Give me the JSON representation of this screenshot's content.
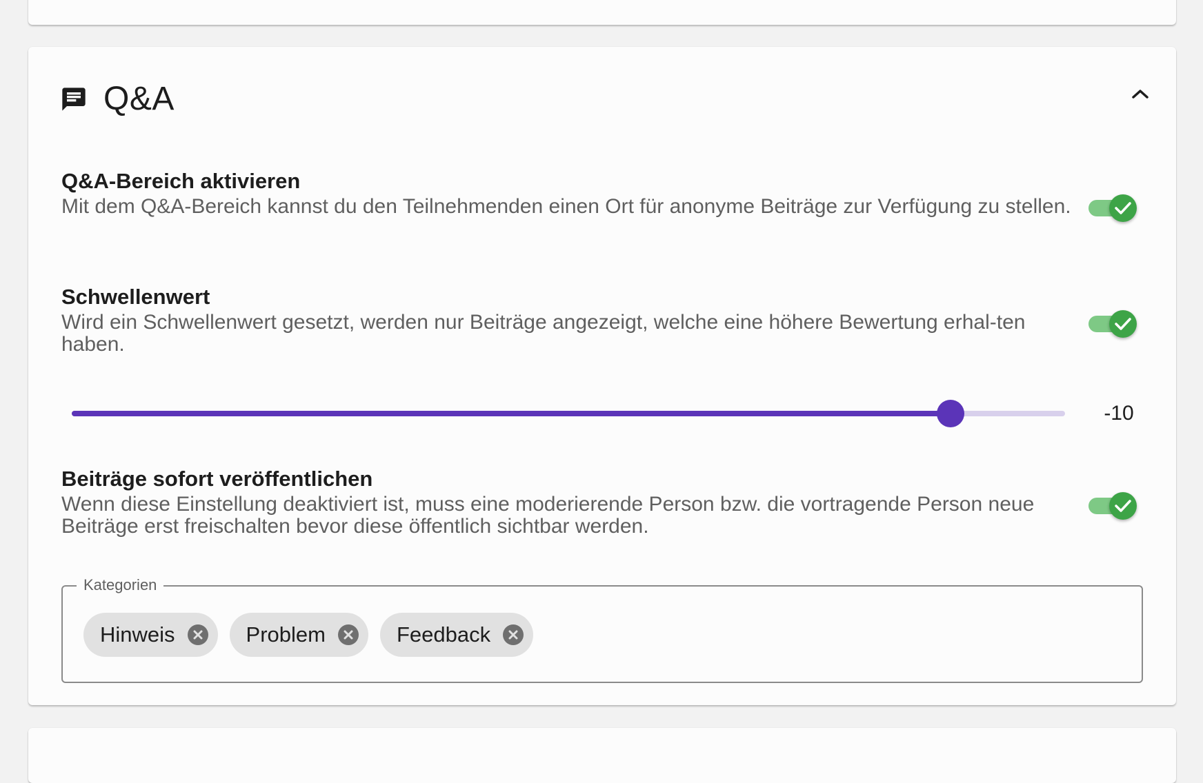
{
  "section": {
    "title": "Q&A",
    "icon": "chat-icon",
    "collapse_icon": "chevron-up-icon"
  },
  "settings": [
    {
      "title": "Q&A-Bereich aktivieren",
      "description": "Mit dem Q&A-Bereich kannst du den Teilnehmenden einen Ort für anonyme Beiträge zur Verfügung zu stellen.",
      "enabled": true
    },
    {
      "title": "Schwellenwert",
      "description": "Wird ein Schwellenwert gesetzt, werden nur Beiträge angezeigt, welche eine höhere Bewertung erhal-ten haben.",
      "enabled": true
    },
    {
      "title": "Beiträge sofort veröffentlichen",
      "description": "Wenn diese Einstellung deaktiviert ist, muss eine moderierende Person bzw. die vortragende Person neue Beiträge erst freischalten bevor diese öffentlich sichtbar werden.",
      "enabled": true
    }
  ],
  "threshold": {
    "value": "-10",
    "fill_fraction": 0.885
  },
  "categories": {
    "legend": "Kategorien",
    "chips": [
      "Hinweis",
      "Problem",
      "Feedback"
    ]
  },
  "colors": {
    "accent": "#5b34b8",
    "switch_on": "#3da447",
    "switch_track": "#7ec985"
  }
}
